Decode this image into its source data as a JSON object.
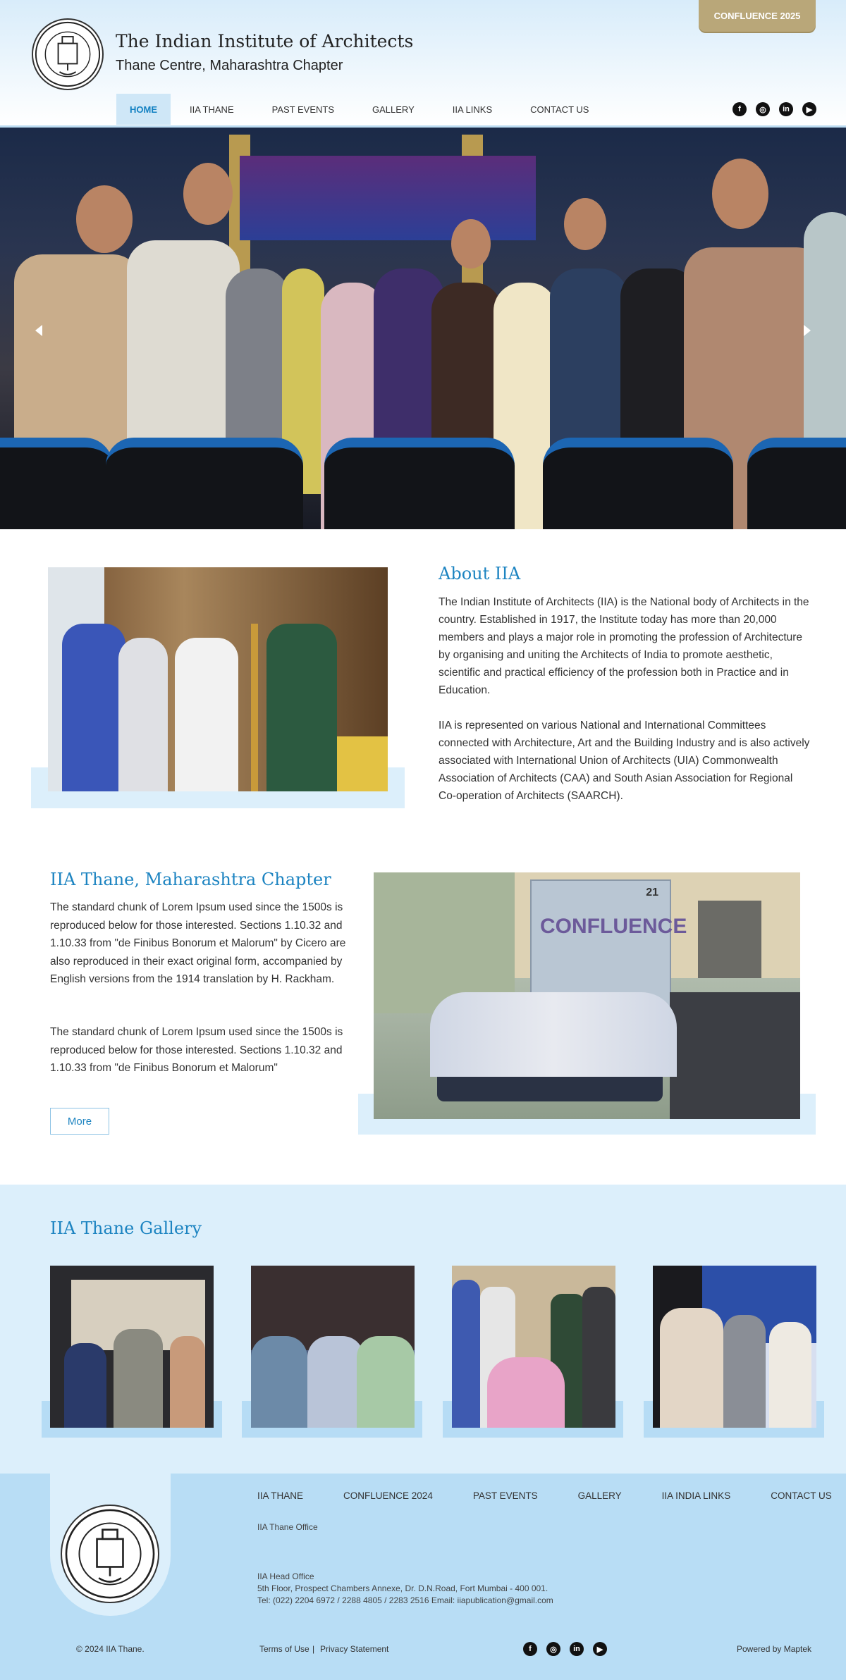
{
  "header": {
    "title": "The Indian Institute of Architects",
    "subtitle": "Thane Centre, Maharashtra Chapter",
    "confluence_button": "CONFLUENCE 2025"
  },
  "nav": {
    "items": [
      {
        "label": "HOME",
        "active": true
      },
      {
        "label": "IIA THANE"
      },
      {
        "label": "PAST EVENTS"
      },
      {
        "label": "GALLERY"
      },
      {
        "label": "IIA LINKS"
      },
      {
        "label": "CONTACT US"
      }
    ]
  },
  "socials": [
    "facebook-icon",
    "instagram-icon",
    "linkedin-icon",
    "youtube-icon"
  ],
  "about": {
    "title": "About IIA",
    "p1": "The Indian Institute of Architects (IIA) is the National body of Architects in the country. Established in 1917, the Institute today has more than 20,000 members and plays a major role in promoting the profession of Architecture by organising and uniting the Architects of India to promote aesthetic, scientific and practical efficiency of the profession both in Practice and in Education.",
    "p2": "IIA is represented on various National and International Committees connected with Architecture, Art and the Building Industry and is also actively associated with International Union of Architects (UIA) Commonwealth Association of Architects (CAA) and South Asian Association for Regional Co-operation of Architects (SAARCH)."
  },
  "chapter": {
    "title": "IIA Thane, Maharashtra Chapter",
    "p1": "The standard chunk of Lorem Ipsum used since the 1500s is reproduced below for those interested. Sections 1.10.32 and 1.10.33 from \"de Finibus Bonorum et Malorum\" by Cicero are also reproduced in their exact original form, accompanied by English versions from the 1914 translation by H. Rackham.",
    "p2": "The standard chunk of Lorem Ipsum used since the 1500s is reproduced below for those interested. Sections 1.10.32 and 1.10.33 from \"de Finibus Bonorum et Malorum\"",
    "more_button": "More",
    "banner_text": "CONFLUENCE",
    "banner_date": "21"
  },
  "gallery": {
    "title": "IIA Thane Gallery"
  },
  "footer": {
    "nav": [
      "IIA THANE",
      "CONFLUENCE 2024",
      "PAST EVENTS",
      "GALLERY",
      "IIA INDIA LINKS",
      "CONTACT US"
    ],
    "office_label": "IIA Thane Office",
    "head_office_label": "IIA Head Office",
    "head_office_address": "5th Floor, Prospect Chambers Annexe, Dr. D.N.Road, Fort Mumbai - 400 001.",
    "head_office_contact": "Tel: (022) 2204 6972 / 2288 4805 / 2283 2516  Email: iiapublication@gmail.com",
    "copyright": "© 2024 IIA Thane.",
    "terms": "Terms of Use",
    "separator": "|",
    "privacy": "Privacy Statement",
    "powered_by": "Powered by Maptek"
  },
  "colors": {
    "accent": "#1d84c1",
    "confluence_gold": "#b9a779",
    "light_blue": "#dceffb",
    "footer_blue": "#b8ddf5"
  }
}
